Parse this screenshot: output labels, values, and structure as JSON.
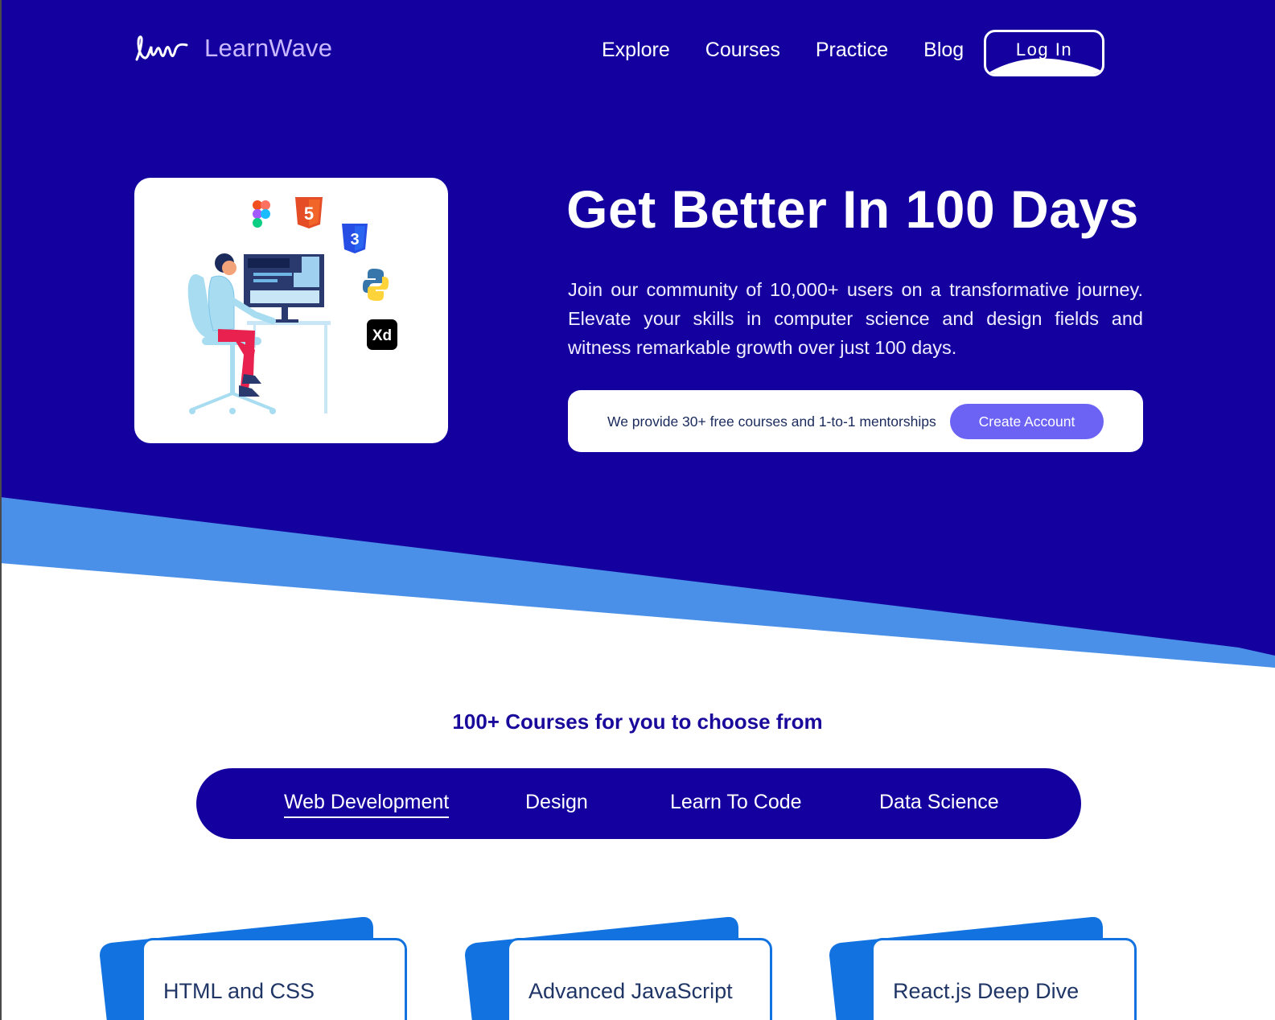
{
  "brand": {
    "name": "LearnWave"
  },
  "nav": {
    "links": [
      "Explore",
      "Courses",
      "Practice",
      "Blog"
    ],
    "login_label": "Log In"
  },
  "hero": {
    "title": "Get Better In 100 Days",
    "description": "Join our community of 10,000+ users on a transformative journey. Elevate your skills in computer science and design fields and witness remarkable growth over just 100 days.",
    "offer_text": "We provide 30+ free courses and 1-to-1 mentorships",
    "cta_label": "Create Account",
    "illustration_icons": [
      "figma-icon",
      "html5-icon",
      "css3-icon",
      "python-icon",
      "adobe-xd-icon"
    ],
    "xd_badge": "Xd"
  },
  "courses": {
    "heading": "100+ Courses for you to choose from",
    "tabs": [
      "Web Development",
      "Design",
      "Learn To Code",
      "Data Science"
    ],
    "active_tab": "Web Development",
    "cards": [
      "HTML and CSS",
      "Advanced JavaScript",
      "React.js Deep Dive"
    ]
  },
  "colors": {
    "hero_bg": "#14009f",
    "accent_wave": "#4a90e8",
    "cta": "#6c63f5",
    "logo_text": "#c9b8ff",
    "card_accent": "#1273e0"
  }
}
